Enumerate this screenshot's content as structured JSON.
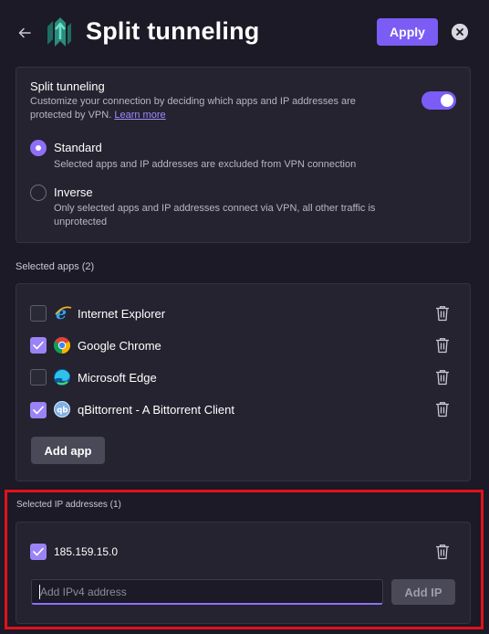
{
  "header": {
    "title": "Split tunneling",
    "apply_label": "Apply"
  },
  "settings": {
    "title": "Split tunneling",
    "description": "Customize your connection by deciding which apps and IP addresses are protected by VPN.",
    "learn_more": "Learn more",
    "enabled": true,
    "modes": [
      {
        "label": "Standard",
        "description": "Selected apps and IP addresses are excluded from VPN connection",
        "selected": true
      },
      {
        "label": "Inverse",
        "description": "Only selected apps and IP addresses connect via VPN, all other traffic is unprotected",
        "selected": false
      }
    ]
  },
  "apps": {
    "section_label": "Selected apps (2)",
    "items": [
      {
        "name": "Internet Explorer",
        "checked": false,
        "icon": "internet-explorer-icon"
      },
      {
        "name": "Google Chrome",
        "checked": true,
        "icon": "chrome-icon"
      },
      {
        "name": "Microsoft Edge",
        "checked": false,
        "icon": "edge-icon"
      },
      {
        "name": "qBittorrent - A Bittorrent Client",
        "checked": true,
        "icon": "qbittorrent-icon"
      }
    ],
    "add_label": "Add app"
  },
  "ips": {
    "section_label": "Selected IP addresses (1)",
    "items": [
      {
        "address": "185.159.15.0",
        "checked": true
      }
    ],
    "input_placeholder": "Add IPv4 address",
    "add_label": "Add IP"
  },
  "colors": {
    "accent": "#7b5cf5",
    "background": "#1b1a26",
    "card": "#24232f",
    "highlight": "#e0121a"
  }
}
